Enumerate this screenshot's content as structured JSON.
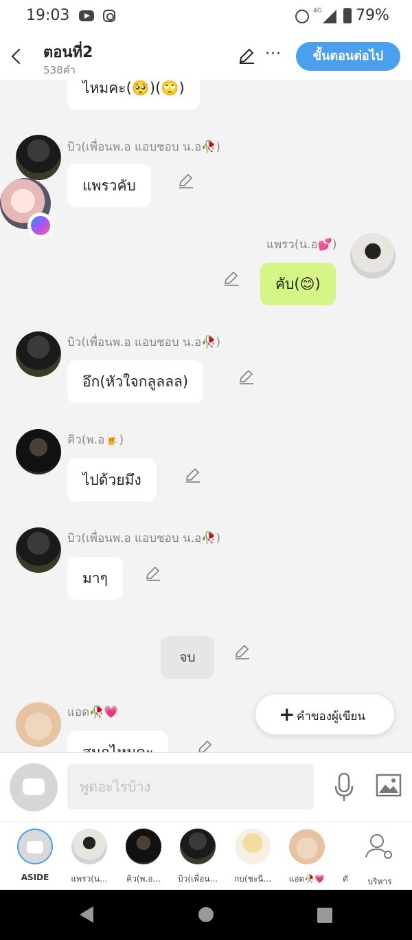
{
  "status_bar": {
    "time": "19:03",
    "network": "4G",
    "battery": "79%"
  },
  "header": {
    "title": "ตอนที่2",
    "subtitle": "538คำ",
    "next_label": "ขั้นตอนต่อไป",
    "more_label": "···"
  },
  "messages": [
    {
      "text": "ไหมคะ(🥺)(🙄)"
    },
    {
      "name": "บิว(เพื่อนพ.อ  แอบชอบ น.อ🥀)",
      "text": "แพรวคับ"
    },
    {
      "name": "แพรว(น.อ💕)",
      "text": "คับ(😊)"
    },
    {
      "name": "บิว(เพื่อนพ.อ  แอบชอบ น.อ🥀)",
      "text": "อึก(หัวใจกลูลลล)"
    },
    {
      "name": "คิว(พ.อ🍺)",
      "text": "ไปด้วยมึง"
    },
    {
      "name": "บิว(เพื่อนพ.อ  แอบชอบ น.อ🥀)",
      "text": "มาๆ"
    },
    {
      "text": "จบ"
    },
    {
      "name": "แอด🥀💗",
      "text": "สนุกไหมคะ"
    }
  ],
  "writer_button": {
    "plus": "+",
    "label": "คำของผู้เขียน"
  },
  "input": {
    "placeholder": "พูดอะไรบ้าง"
  },
  "characters": [
    {
      "label": "ASIDE"
    },
    {
      "label": "แพรว(น..."
    },
    {
      "label": "คิว(พ.อ..."
    },
    {
      "label": "บิว(เพื่อน..."
    },
    {
      "label": "กบ(ชะนี..."
    },
    {
      "label": "แอด🥀💗"
    },
    {
      "label": "ตั"
    },
    {
      "label": "บริหาร"
    }
  ]
}
